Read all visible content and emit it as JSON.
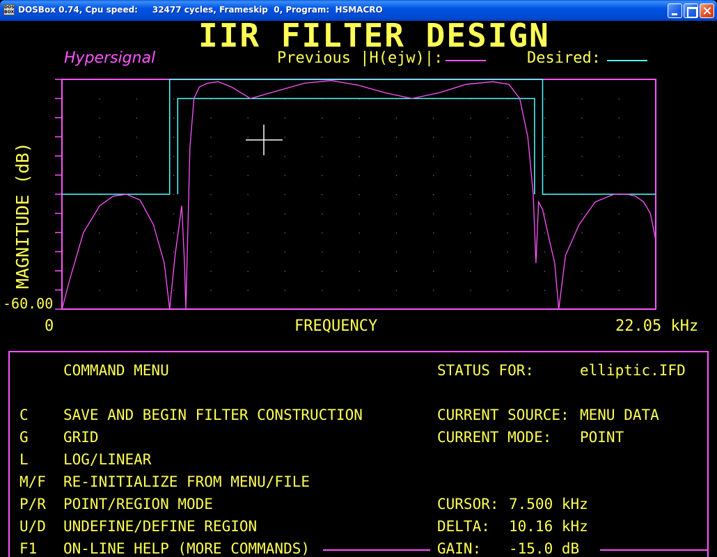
{
  "window": {
    "title": "DOSBox 0.74, Cpu speed:     32477 cycles, Frameskip  0, Program:  HSMACRO",
    "icon": "dosbox-icon",
    "icon_text": "DOS BOX"
  },
  "app": {
    "title": "IIR FILTER DESIGN",
    "brand": "Hypersignal",
    "legend_previous": "Previous |H(ejw)|:",
    "legend_desired": "Desired:"
  },
  "colors": {
    "text": "#ffff55",
    "frame": "#ff55ff",
    "response": "#ff55ff",
    "desired": "#55ffff",
    "grid_dots": "#8a8a8a",
    "cursor": "#ffffff"
  },
  "plot": {
    "y_label": "MAGNITUDE (dB)",
    "y_min_label": "-60.00",
    "x_min_label": "0",
    "x_label": "FREQUENCY",
    "x_max_label": "22.05 kHz"
  },
  "chart_data": {
    "type": "line",
    "xlabel": "FREQUENCY",
    "ylabel": "MAGNITUDE (dB)",
    "xlim": [
      0,
      22.05
    ],
    "ylim": [
      -60,
      0
    ],
    "x_unit": "kHz",
    "series": [
      {
        "name": "Previous |H(ejw)|",
        "kind": "elliptic bandpass response",
        "points": [
          [
            0.0,
            -60.0
          ],
          [
            0.3,
            -52.0
          ],
          [
            0.8,
            -40.0
          ],
          [
            1.4,
            -33.0
          ],
          [
            1.9,
            -30.5
          ],
          [
            2.4,
            -30.0
          ],
          [
            2.9,
            -31.5
          ],
          [
            3.4,
            -38.0
          ],
          [
            3.8,
            -48.0
          ],
          [
            4.0,
            -60.0
          ],
          [
            4.2,
            -46.0
          ],
          [
            4.45,
            -33.0
          ],
          [
            4.55,
            -48.0
          ],
          [
            4.6,
            -60.0
          ],
          [
            4.75,
            -18.0
          ],
          [
            4.9,
            -5.0
          ],
          [
            5.1,
            -2.0
          ],
          [
            5.4,
            -1.0
          ],
          [
            5.8,
            -0.6
          ],
          [
            6.3,
            -2.0
          ],
          [
            7.0,
            -5.0
          ],
          [
            8.0,
            -3.0
          ],
          [
            9.0,
            -1.0
          ],
          [
            10.0,
            -0.3
          ],
          [
            11.0,
            -1.5
          ],
          [
            12.0,
            -3.5
          ],
          [
            13.0,
            -5.0
          ],
          [
            14.0,
            -3.5
          ],
          [
            15.0,
            -1.3
          ],
          [
            16.0,
            -0.6
          ],
          [
            16.6,
            -1.3
          ],
          [
            17.0,
            -5.0
          ],
          [
            17.3,
            -15.0
          ],
          [
            17.5,
            -30.0
          ],
          [
            17.6,
            -48.0
          ],
          [
            17.7,
            -32.0
          ],
          [
            17.85,
            -34.0
          ],
          [
            18.1,
            -42.0
          ],
          [
            18.3,
            -48.0
          ],
          [
            18.45,
            -60.0
          ],
          [
            18.7,
            -46.0
          ],
          [
            19.2,
            -38.0
          ],
          [
            19.8,
            -32.0
          ],
          [
            20.5,
            -30.0
          ],
          [
            21.0,
            -30.0
          ],
          [
            21.3,
            -30.5
          ],
          [
            21.6,
            -32.0
          ],
          [
            21.85,
            -35.0
          ],
          [
            22.05,
            -42.0
          ],
          [
            22.05,
            -60.0
          ]
        ]
      },
      {
        "name": "Desired",
        "kind": "bandpass tolerance mask",
        "upper_bound": [
          [
            0.0,
            -30.0
          ],
          [
            4.0,
            -30.0
          ],
          [
            4.0,
            0.0
          ],
          [
            17.85,
            0.0
          ],
          [
            17.85,
            -30.0
          ],
          [
            22.05,
            -30.0
          ]
        ],
        "lower_bound": [
          [
            4.3,
            -30.0
          ],
          [
            4.3,
            -5.0
          ],
          [
            17.55,
            -5.0
          ],
          [
            17.55,
            -30.0
          ]
        ]
      }
    ],
    "grid": true,
    "cursor": {
      "x_khz": 7.5,
      "gain_db": -15.0
    }
  },
  "command_menu": {
    "heading": "COMMAND MENU",
    "items": [
      {
        "key": "C",
        "label": "SAVE AND BEGIN FILTER CONSTRUCTION"
      },
      {
        "key": "G",
        "label": "GRID"
      },
      {
        "key": "L",
        "label": "LOG/LINEAR"
      },
      {
        "key": "M/F",
        "label": "RE-INITIALIZE FROM MENU/FILE"
      },
      {
        "key": "P/R",
        "label": "POINT/REGION MODE"
      },
      {
        "key": "U/D",
        "label": "UNDEFINE/DEFINE REGION"
      },
      {
        "key": "F1",
        "label": "ON-LINE HELP (MORE COMMANDS)"
      }
    ]
  },
  "status": {
    "heading": "STATUS FOR:",
    "filename": "elliptic.IFD",
    "source_label": "CURRENT SOURCE:",
    "source_value": "MENU DATA",
    "mode_label": "CURRENT MODE:",
    "mode_value": "POINT",
    "cursor_label": "CURSOR:",
    "cursor_value": "7.500 kHz",
    "delta_label": "DELTA:",
    "delta_value": "10.16 kHz",
    "gain_label": "GAIN:",
    "gain_value": "-15.0 dB"
  }
}
